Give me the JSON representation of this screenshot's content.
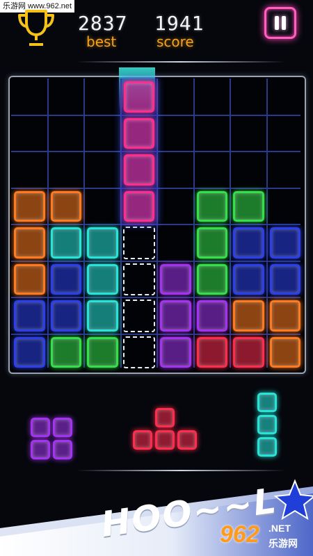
{
  "watermark": {
    "text": "乐游网 www.962.net"
  },
  "hud": {
    "best_value": "2837",
    "best_label": "best",
    "score_value": "1941",
    "score_label": "score"
  },
  "icons": {
    "trophy": "trophy-icon",
    "pause": "pause-icon",
    "star": "star-icon"
  },
  "colors": {
    "orange": "#ff7a1e",
    "cyan": "#28e4d8",
    "blue": "#2c3fe8",
    "green": "#34e04a",
    "purple": "#a333f0",
    "red": "#ff2c4e",
    "magenta": "#ff2e8a",
    "grid": "#2a3a8a",
    "accent_text": "#f7a21c"
  },
  "board": {
    "size": 8,
    "rows": [
      "........",
      "........",
      "........",
      "oo...gg.",
      "occ..gbb",
      "obc.pgbb",
      "bbc.ppoo",
      "bgg.prro"
    ],
    "falling_piece": {
      "color": "magenta",
      "column": 3,
      "rows": [
        0,
        1,
        2,
        3
      ]
    },
    "ghost_cells": {
      "column": 3,
      "rows": [
        4,
        5,
        6,
        7
      ]
    },
    "lane_column": 3
  },
  "tray": [
    {
      "name": "tray-piece-square",
      "color": "purple",
      "cells": [
        [
          0,
          0
        ],
        [
          0,
          1
        ],
        [
          1,
          0
        ],
        [
          1,
          1
        ]
      ]
    },
    {
      "name": "tray-piece-t",
      "color": "red",
      "cells": [
        [
          0,
          1
        ],
        [
          1,
          0
        ],
        [
          1,
          1
        ],
        [
          1,
          2
        ]
      ]
    },
    {
      "name": "tray-piece-i3",
      "color": "cyan",
      "cells": [
        [
          0,
          0
        ],
        [
          1,
          0
        ],
        [
          2,
          0
        ]
      ]
    }
  ],
  "banner": {
    "text": "HOO~~L"
  },
  "brand": {
    "text": "962",
    "sub_text": "乐游网",
    "suffix": ".NET"
  }
}
